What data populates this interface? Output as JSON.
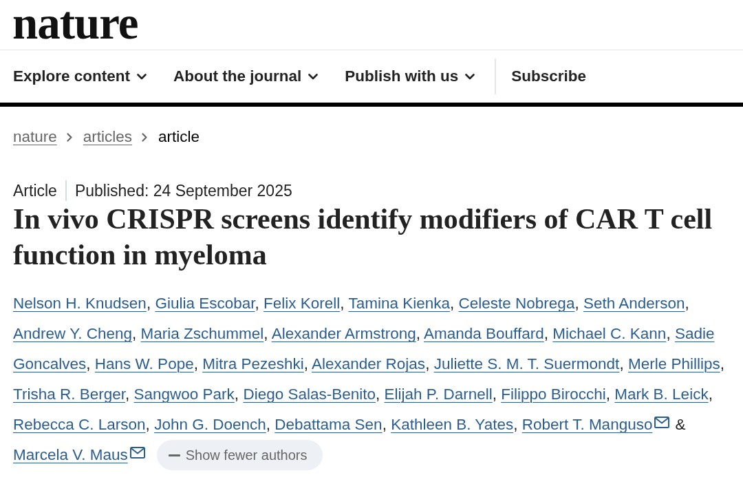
{
  "logo": "nature",
  "nav": [
    {
      "label": "Explore content",
      "kind": "menu"
    },
    {
      "label": "About the journal",
      "kind": "menu"
    },
    {
      "label": "Publish with us",
      "kind": "menu"
    },
    {
      "label": "Subscribe",
      "kind": "link"
    }
  ],
  "breadcrumb": [
    {
      "label": "nature",
      "current": false
    },
    {
      "label": "articles",
      "current": false
    },
    {
      "label": "article",
      "current": true
    }
  ],
  "article": {
    "type": "Article",
    "published": "Published: 24 September 2025",
    "title": "In vivo CRISPR screens identify modifiers of CAR T cell function in myeloma",
    "author_lines": [
      {
        "authors": [
          {
            "name": "Nelson H. Knudsen",
            "after": ",",
            "email": false
          },
          {
            "name": "Giulia Escobar",
            "after": ",",
            "email": false
          },
          {
            "name": "Felix Korell",
            "after": ",",
            "email": false
          },
          {
            "name": "Tamina Kienka",
            "after": ",",
            "email": false
          },
          {
            "name": "Celeste Nobrega",
            "after": ",",
            "email": false
          },
          {
            "name": "Seth Anderson",
            "after": ",",
            "email": false
          }
        ]
      },
      {
        "authors": [
          {
            "name": "Andrew Y. Cheng",
            "after": ",",
            "email": false
          },
          {
            "name": "Maria Zschummel",
            "after": ",",
            "email": false
          },
          {
            "name": "Alexander Armstrong",
            "after": ",",
            "email": false
          },
          {
            "name": "Amanda Bouffard",
            "after": ",",
            "email": false
          },
          {
            "name": "Michael C. Kann",
            "after": ",",
            "email": false
          },
          {
            "name": "Sadie",
            "email": false
          }
        ]
      },
      {
        "authors": [
          {
            "name": "Goncalves",
            "after": ",",
            "email": false
          },
          {
            "name": "Hans W. Pope",
            "after": ",",
            "email": false
          },
          {
            "name": "Mitra Pezeshki",
            "after": ",",
            "email": false
          },
          {
            "name": "Alexander Rojas",
            "after": ",",
            "email": false
          },
          {
            "name": "Juliette S. M. T. Suermondt",
            "after": ",",
            "email": false
          },
          {
            "name": "Merle Phillips",
            "after": ",",
            "email": false
          }
        ]
      },
      {
        "authors": [
          {
            "name": "Trisha R. Berger",
            "after": ",",
            "email": false
          },
          {
            "name": "Sangwoo Park",
            "after": ",",
            "email": false
          },
          {
            "name": "Diego Salas-Benito",
            "after": ",",
            "email": false
          },
          {
            "name": "Elijah P. Darnell",
            "after": ",",
            "email": false
          },
          {
            "name": "Filippo Birocchi",
            "after": ",",
            "email": false
          },
          {
            "name": "Mark B. Leick",
            "after": ",",
            "email": false
          }
        ]
      },
      {
        "authors": [
          {
            "name": "Rebecca C. Larson",
            "after": ",",
            "email": false
          },
          {
            "name": "John G. Doench",
            "after": ",",
            "email": false
          },
          {
            "name": "Debattama Sen",
            "after": ",",
            "email": false
          },
          {
            "name": "Kathleen B. Yates",
            "after": ",",
            "email": false
          },
          {
            "name": "Robert T. Manguso",
            "after": "&",
            "email": true
          }
        ]
      },
      {
        "authors": [
          {
            "name": "Marcela V. Maus",
            "email": true
          }
        ]
      }
    ],
    "toggle_button": "Show fewer authors"
  }
}
